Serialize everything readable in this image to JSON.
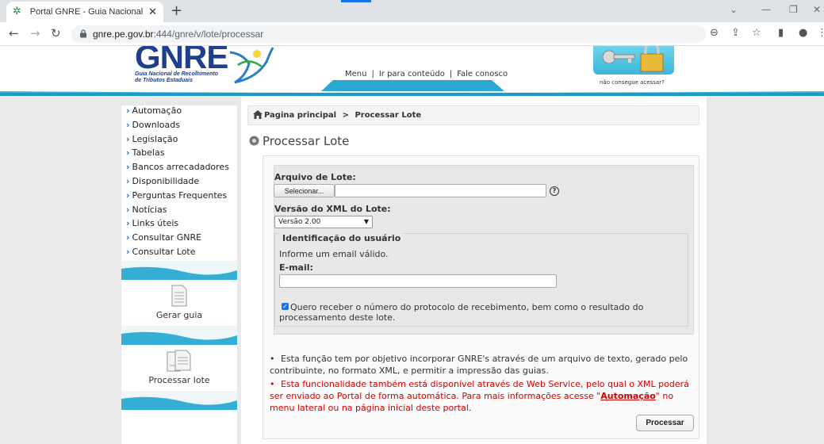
{
  "browser": {
    "tab_title": "Portal GNRE - Guia Nacional de R",
    "tab_close": "✕",
    "new_tab": "+",
    "url_host": "gnre.pe.gov.br",
    "url_path": ":444/gnre/v/lote/processar"
  },
  "header": {
    "logo_text": "GNRE",
    "logo_sub_1": "Guia Nacional de Recolhimento",
    "logo_sub_2": "de Tributos Estaduais",
    "menu": [
      "Menu",
      "Ir para conteúdo",
      "Fale conosco"
    ],
    "menu_sep": "|",
    "access_label": "não consegue acessar?"
  },
  "sidebar": {
    "items": [
      {
        "label": "Automação"
      },
      {
        "label": "Downloads"
      },
      {
        "label": "Legislação"
      },
      {
        "label": "Tabelas"
      },
      {
        "label": "Bancos arrecadadores"
      },
      {
        "label": "Disponibilidade"
      },
      {
        "label": "Perguntas Frequentes"
      },
      {
        "label": "Notícias"
      },
      {
        "label": "Links úteis"
      },
      {
        "label": "Consultar GNRE"
      },
      {
        "label": "Consultar Lote"
      }
    ],
    "bullet": "›",
    "box_gerar": "Gerar guia",
    "box_processar": "Processar lote"
  },
  "breadcrumb": {
    "home": "Pagina principal",
    "sep": ">",
    "current": "Processar Lote"
  },
  "page": {
    "title": "Processar Lote"
  },
  "form": {
    "file_label": "Arquivo de Lote:",
    "file_button": "Selecionar...",
    "file_value": "",
    "help": "?",
    "version_label": "Versão do XML do Lote:",
    "version_selected": "Versão 2.00",
    "fieldset_legend": "Identificação do usuário",
    "email_info": "Informe um email válido.",
    "email_label": "E-mail:",
    "email_value": "",
    "checkbox_checked": true,
    "checkbox_mark": "✓",
    "checkbox_label": "Quero receber o número do protocolo de recebimento, bem como o resultado do processamento deste lote.",
    "submit_label": "Processar"
  },
  "notes": {
    "bullet": "•",
    "note1": "Esta função tem por objetivo incorporar GNRE's através de um arquivo de texto, gerado pelo contribuinte, no formato XML, e permitir a impressão das guias.",
    "note2_pre": "Esta funcionalidade também está disponível através de Web Service, pelo qual o XML poderá ser enviado ao Portal de forma automática. Para mais informações acesse \"",
    "note2_link": "Automação",
    "note2_post": "\" no menu lateral ou na página inicial deste portal."
  },
  "colors": {
    "accent_blue": "#1d6fb7",
    "wave_cyan": "#3bb7d8",
    "warning_red": "#d40000"
  }
}
